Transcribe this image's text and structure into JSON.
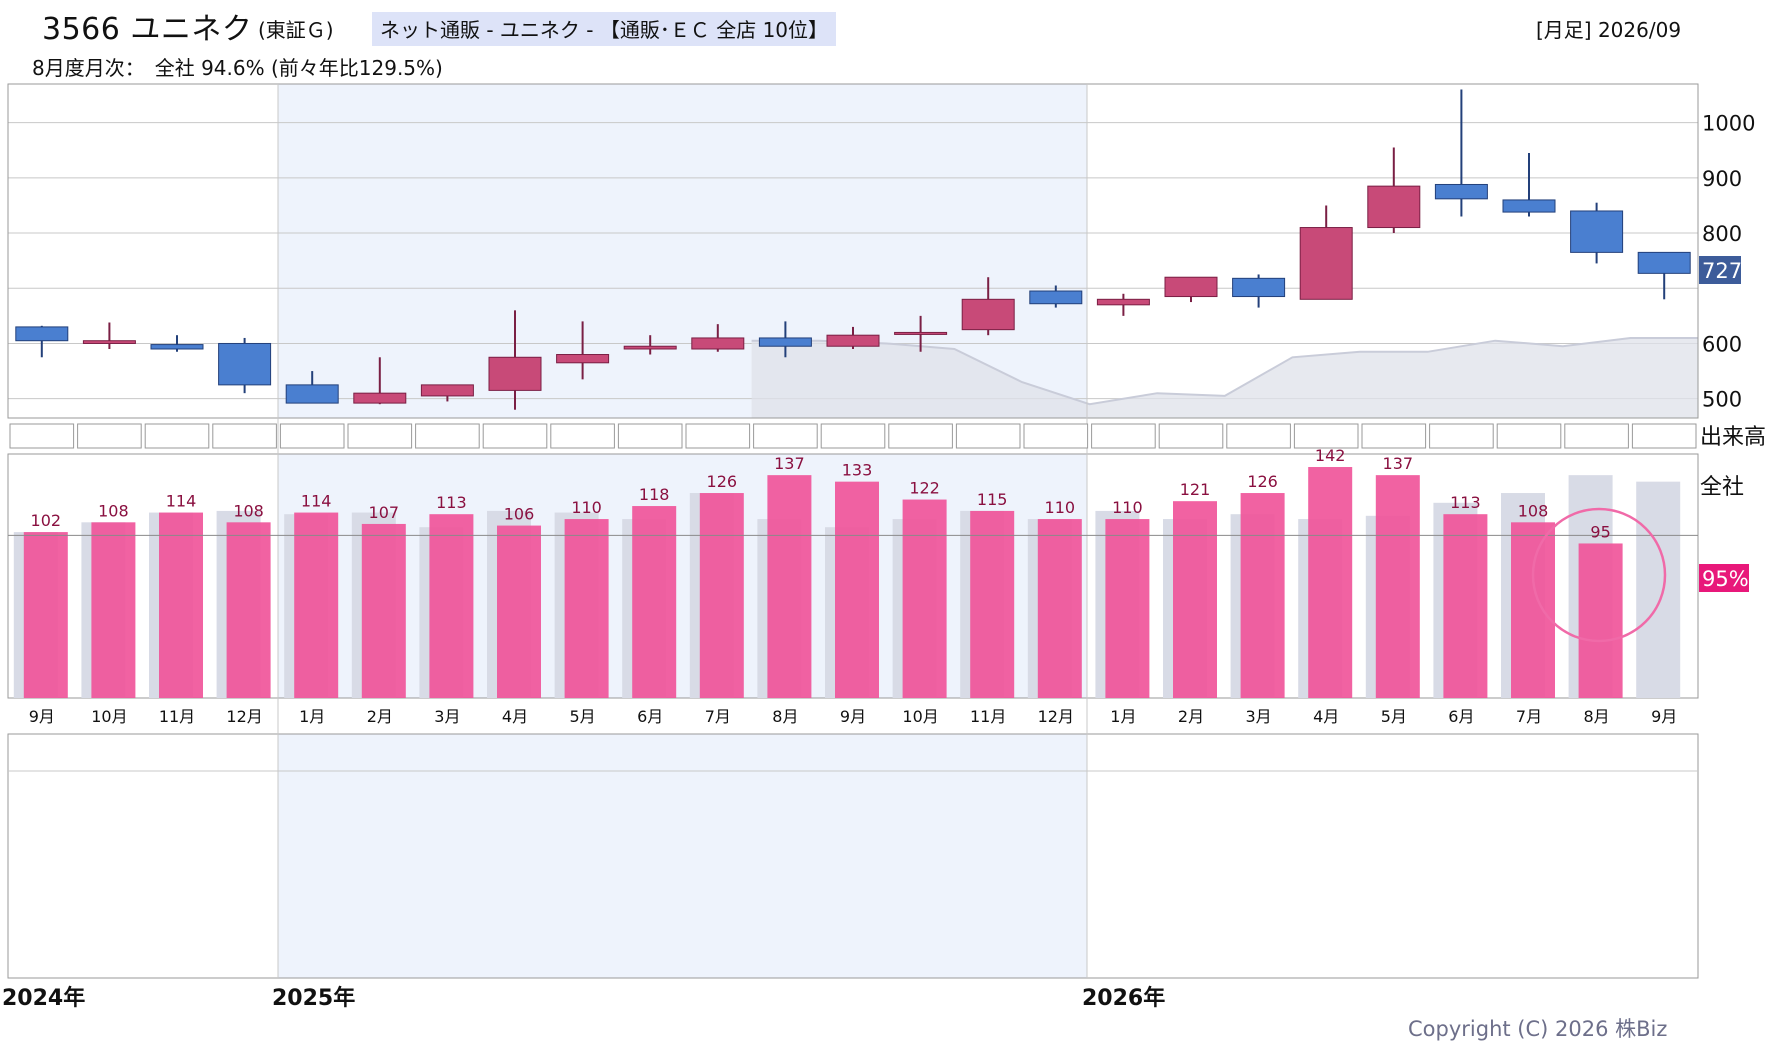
{
  "header": {
    "code_name": "3566 ユニネク",
    "market": "(東証Ｇ)",
    "sector": "ネット通販 - ユニネク - 【通販･ＥＣ 全店 10位】",
    "period": "[月足] 2026/09",
    "monthly": "8月度月次：　全社 94.6% (前々年比129.5%)"
  },
  "labels": {
    "volume": "出来高",
    "all_company": "全社",
    "last_price": "727",
    "last_pct": "95%",
    "copyright": "Copyright (C) 2026 株Biz"
  },
  "years": [
    "2024年",
    "2025年",
    "2026年"
  ],
  "colors": {
    "up": "#c84a78",
    "down": "#4a7fd0",
    "bar": "#f0559a",
    "bar_prev": "#d8dbe6",
    "highlight": "#eef3fc",
    "price_tag": "#3d5c9a",
    "pct_tag": "#e8187a",
    "label": "#8a1040"
  },
  "chart_data": [
    {
      "type": "candlestick",
      "name": "price",
      "categories": [
        "9月",
        "10月",
        "11月",
        "12月",
        "1月",
        "2月",
        "3月",
        "4月",
        "5月",
        "6月",
        "7月",
        "8月",
        "9月",
        "10月",
        "11月",
        "12月",
        "1月",
        "2月",
        "3月",
        "4月",
        "5月",
        "6月",
        "7月",
        "8月",
        "9月"
      ],
      "yticks": [
        500,
        600,
        800,
        900,
        1000
      ],
      "ylim": [
        465,
        1070
      ],
      "ohlc": [
        [
          630,
          632,
          575,
          605
        ],
        [
          600,
          638,
          590,
          605
        ],
        [
          598,
          615,
          585,
          590
        ],
        [
          600,
          610,
          510,
          525
        ],
        [
          525,
          550,
          495,
          492
        ],
        [
          492,
          575,
          490,
          510
        ],
        [
          505,
          520,
          495,
          525
        ],
        [
          515,
          660,
          480,
          575
        ],
        [
          565,
          640,
          535,
          580
        ],
        [
          590,
          615,
          580,
          595
        ],
        [
          590,
          635,
          585,
          610
        ],
        [
          610,
          640,
          575,
          595
        ],
        [
          595,
          630,
          590,
          615
        ],
        [
          618,
          650,
          585,
          620
        ],
        [
          625,
          720,
          615,
          680
        ],
        [
          695,
          705,
          665,
          672
        ],
        [
          670,
          690,
          650,
          680
        ],
        [
          685,
          720,
          675,
          720
        ],
        [
          718,
          725,
          665,
          685
        ],
        [
          680,
          850,
          680,
          810
        ],
        [
          810,
          955,
          800,
          885
        ],
        [
          888,
          1060,
          830,
          862
        ],
        [
          860,
          945,
          830,
          838
        ],
        [
          840,
          855,
          745,
          765
        ],
        [
          765,
          760,
          680,
          727
        ]
      ],
      "reference_line": [
        605,
        605,
        600,
        590,
        530,
        490,
        510,
        505,
        575,
        585,
        585,
        605,
        595,
        610
      ]
    },
    {
      "type": "bar",
      "name": "monthly_sales_pct",
      "categories": [
        "9月",
        "10月",
        "11月",
        "12月",
        "1月",
        "2月",
        "3月",
        "4月",
        "5月",
        "6月",
        "7月",
        "8月",
        "9月",
        "10月",
        "11月",
        "12月",
        "1月",
        "2月",
        "3月",
        "4月",
        "5月",
        "6月",
        "7月",
        "8月",
        "9月"
      ],
      "values": [
        102,
        108,
        114,
        108,
        114,
        107,
        113,
        106,
        110,
        118,
        126,
        137,
        133,
        122,
        115,
        110,
        110,
        121,
        126,
        142,
        137,
        113,
        108,
        95,
        null
      ],
      "prev_values": [
        102,
        108,
        114,
        115,
        113,
        114,
        105,
        115,
        114,
        110,
        126,
        110,
        105,
        110,
        115,
        110,
        115,
        110,
        113,
        110,
        112,
        120,
        126,
        137,
        133
      ],
      "reference": 100,
      "ylim": [
        0,
        150
      ],
      "highlight_index": 23
    }
  ]
}
